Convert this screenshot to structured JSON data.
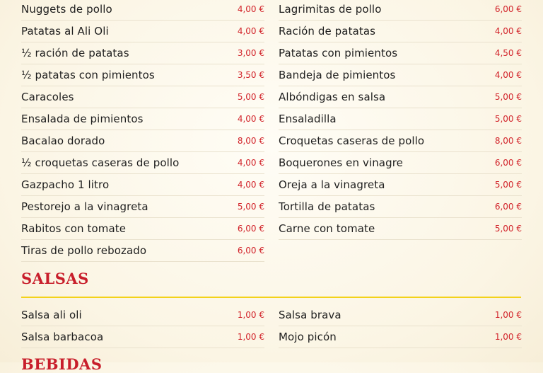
{
  "items_left": [
    {
      "name": "Nuggets de pollo",
      "price": "4,00 €"
    },
    {
      "name": "Patatas al Ali Oli",
      "price": "4,00 €"
    },
    {
      "name": "½ ración de patatas",
      "price": "3,00 €"
    },
    {
      "name": "½ patatas con pimientos",
      "price": "3,50 €"
    },
    {
      "name": "Caracoles",
      "price": "5,00 €"
    },
    {
      "name": "Ensalada de pimientos",
      "price": "4,00 €"
    },
    {
      "name": "Bacalao dorado",
      "price": "8,00 €"
    },
    {
      "name": "½ croquetas caseras de pollo",
      "price": "4,00 €"
    },
    {
      "name": "Gazpacho 1 litro",
      "price": "4,00 €"
    },
    {
      "name": "Pestorejo a la vinagreta",
      "price": "5,00 €"
    },
    {
      "name": "Rabitos con tomate",
      "price": "6,00 €"
    },
    {
      "name": "Tiras de pollo rebozado",
      "price": "6,00 €"
    }
  ],
  "items_right": [
    {
      "name": "Lagrimitas de pollo",
      "price": "6,00 €"
    },
    {
      "name": "Ración de patatas",
      "price": "4,00 €"
    },
    {
      "name": "Patatas con pimientos",
      "price": "4,50 €"
    },
    {
      "name": "Bandeja de pimientos",
      "price": "4,00 €"
    },
    {
      "name": "Albóndigas en salsa",
      "price": "5,00 €"
    },
    {
      "name": "Ensaladilla",
      "price": "5,00 €"
    },
    {
      "name": "Croquetas caseras de pollo",
      "price": "8,00 €"
    },
    {
      "name": "Boquerones en vinagre",
      "price": "6,00 €"
    },
    {
      "name": "Oreja a la vinagreta",
      "price": "5,00 €"
    },
    {
      "name": "Tortilla de patatas",
      "price": "6,00 €"
    },
    {
      "name": "Carne con tomate",
      "price": "5,00 €"
    }
  ],
  "salsas": {
    "title": "SALSAS",
    "left": [
      {
        "name": "Salsa ali oli",
        "price": "1,00 €"
      },
      {
        "name": "Salsa barbacoa",
        "price": "1,00 €"
      }
    ],
    "right": [
      {
        "name": "Salsa brava",
        "price": "1,00 €"
      },
      {
        "name": "Mojo picón",
        "price": "1,00 €"
      }
    ]
  },
  "next_section": {
    "title": "BEBIDAS"
  },
  "colors": {
    "accent": "#c81e2b",
    "price": "#d2232a",
    "rule": "#f3d21a",
    "divider": "#e9e1cd"
  }
}
